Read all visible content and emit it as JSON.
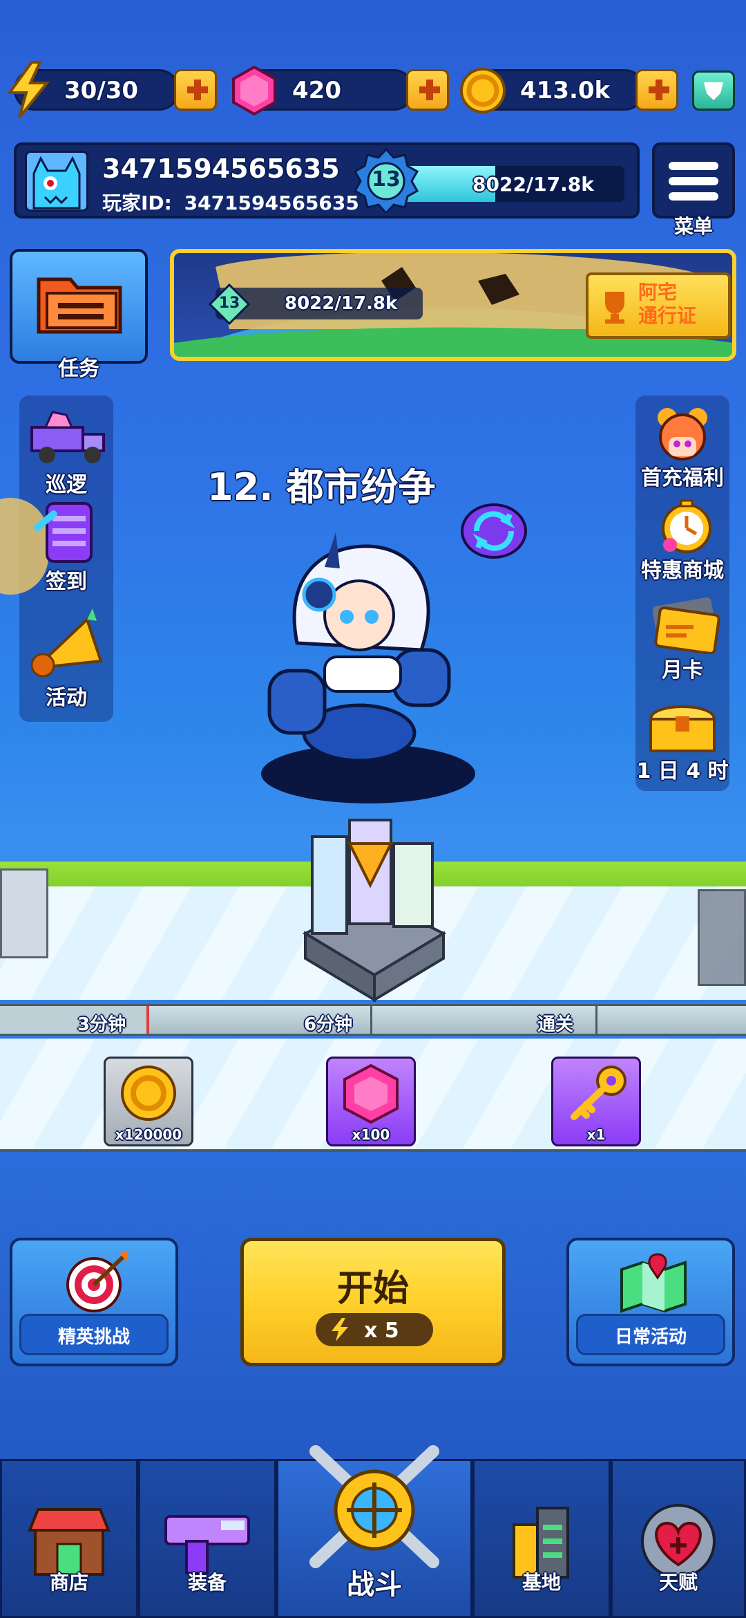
{
  "resources": {
    "energy": "30/30",
    "gems": "420",
    "coins": "413.0k"
  },
  "profile": {
    "name": "3471594565635",
    "id_label": "玩家ID:",
    "id_value": "3471594565635",
    "level": "13",
    "xp": "8022/17.8k",
    "xp_fraction": 0.45
  },
  "menu": {
    "label": "菜单"
  },
  "tasks": {
    "label": "任务"
  },
  "pass_banner": {
    "level": "13",
    "xp": "8022/17.8k",
    "button_label": "阿宅\n通行证"
  },
  "left_menu": [
    {
      "label": "巡逻",
      "icon": "truck-icon"
    },
    {
      "label": "签到",
      "icon": "checkin-icon"
    },
    {
      "label": "活动",
      "icon": "horn-icon"
    }
  ],
  "right_menu": [
    {
      "label": "首充福利",
      "icon": "girl-avatar-icon"
    },
    {
      "label": "特惠商城",
      "icon": "stopwatch-icon"
    },
    {
      "label": "月卡",
      "icon": "card-icon"
    },
    {
      "label": "1 日 4 时",
      "icon": "chest-icon"
    }
  ],
  "stage": {
    "title": "12. 都市纷争"
  },
  "progress": {
    "milestones": [
      "3分钟",
      "6分钟",
      "通关"
    ],
    "rewards": [
      {
        "icon": "coin-icon",
        "count": "x120000"
      },
      {
        "icon": "gem-icon",
        "count": "x100"
      },
      {
        "icon": "key-icon",
        "count": "x1"
      }
    ]
  },
  "actions": {
    "elite": "精英挑战",
    "start": "开始",
    "start_cost": "x 5",
    "daily": "日常活动"
  },
  "bottom_nav": [
    {
      "label": "商店"
    },
    {
      "label": "装备"
    },
    {
      "label": "战斗"
    },
    {
      "label": "基地"
    },
    {
      "label": "天赋"
    }
  ],
  "colors": {
    "accent_yellow": "#ffd02b",
    "panel_navy": "#12286b",
    "gem_pink": "#ff3fa4",
    "xp_cyan": "#3fe0e6",
    "green_track": "#7ed321"
  }
}
